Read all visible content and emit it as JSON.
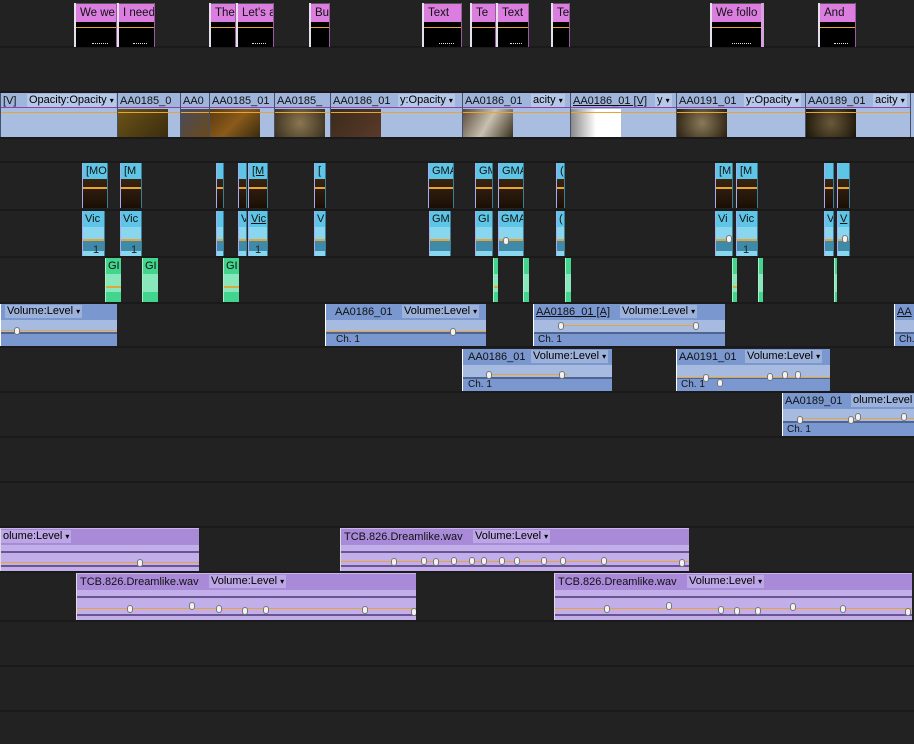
{
  "app": "Video Editing Timeline (Sequence)",
  "colors": {
    "background": "#222222",
    "title_clip": "#db7ee0",
    "video_clip": "#a8bde0",
    "cyan_clip": "#5ec5e6",
    "green_clip": "#43d48e",
    "audio_clip": "#7a98cf",
    "music_clip": "#a98ad9",
    "rubber_band": "#e8a536"
  },
  "title_track": {
    "clips": [
      "We we",
      "I need",
      "The",
      "Let's a",
      "Bu",
      "Text",
      "Te",
      "Text",
      "Te",
      "We follo",
      "And"
    ]
  },
  "video_track": {
    "clips": [
      {
        "name": "[V]",
        "prop": "Opacity:Opacity"
      },
      {
        "name": "AA0185_0",
        "prop": ""
      },
      {
        "name": "AA0",
        "prop": ""
      },
      {
        "name": "AA0185_01",
        "prop": ""
      },
      {
        "name": "AA0185_",
        "prop": ""
      },
      {
        "name": "AA0186_01",
        "prop": "y:Opacity"
      },
      {
        "name": "AA0186_01",
        "prop": "acity"
      },
      {
        "name": "AA0186_01 [V]",
        "prop": "y"
      },
      {
        "name": "AA0191_01",
        "prop": "y:Opacity"
      },
      {
        "name": "AA0189_01",
        "prop": "acity"
      }
    ]
  },
  "cyan_video_track": {
    "clips": [
      "[MO",
      "[M",
      "",
      "",
      "[M",
      "[",
      "GMA",
      "GM",
      "GMA",
      "(",
      "[M",
      "[M",
      "",
      ""
    ]
  },
  "cyan_audio_track": {
    "clips": [
      "Vic",
      "Vic",
      "",
      "V",
      "Vic",
      "V",
      "GM",
      "GI",
      "GMA",
      "(",
      "Vi",
      "Vic",
      "V",
      "V"
    ],
    "channel_label": "1"
  },
  "green_track": {
    "clips": [
      "GI",
      "GI",
      "GI",
      "",
      "",
      "",
      "",
      "",
      ""
    ]
  },
  "audio_track_1": {
    "clips": [
      {
        "name": "",
        "prop": "Volume:Level",
        "ch": ""
      },
      {
        "name": "AA0186_01",
        "prop": "Volume:Level",
        "ch": "Ch. 1"
      },
      {
        "name": "AA0186_01 [A]",
        "prop": "Volume:Level",
        "ch": "Ch. 1"
      },
      {
        "name": "AA",
        "prop": "",
        "ch": "Ch."
      }
    ]
  },
  "audio_track_2": {
    "clips": [
      {
        "name": "AA0186_01",
        "prop": "Volume:Level",
        "ch": "Ch. 1"
      },
      {
        "name": "AA0191_01",
        "prop": "Volume:Level",
        "ch": "Ch. 1"
      }
    ]
  },
  "audio_track_3": {
    "clips": [
      {
        "name": "AA0189_01",
        "prop": "olume:Level",
        "ch": "Ch. 1"
      }
    ]
  },
  "music_track_1": {
    "clips": [
      {
        "name": "",
        "prop": "olume:Level"
      },
      {
        "name": "TCB.826.Dreamlike.wav",
        "prop": "Volume:Level"
      }
    ]
  },
  "music_track_2": {
    "clips": [
      {
        "name": "TCB.826.Dreamlike.wav",
        "prop": "Volume:Level"
      },
      {
        "name": "TCB.826.Dreamlike.wav",
        "prop": "Volume:Level"
      }
    ]
  },
  "dropdown_glyph": "▾"
}
